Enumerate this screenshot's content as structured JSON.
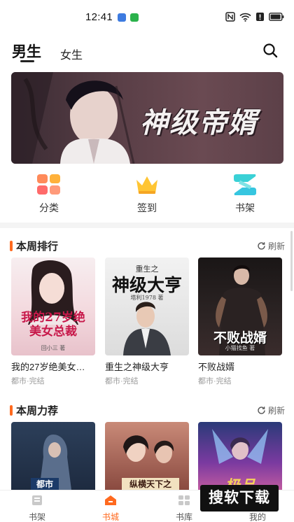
{
  "status_bar": {
    "time": "12:41"
  },
  "header": {
    "tabs": [
      {
        "label": "男生"
      },
      {
        "label": "女生"
      }
    ]
  },
  "banner": {
    "title": "神级帝婿"
  },
  "quick_entries": [
    {
      "label": "分类",
      "icon": "category-icon"
    },
    {
      "label": "签到",
      "icon": "crown-icon"
    },
    {
      "label": "书架",
      "icon": "bookshelf-icon"
    }
  ],
  "sections": [
    {
      "title": "本周排行",
      "refresh_label": "刷新",
      "books": [
        {
          "title": "我的27岁绝美女…",
          "meta": "都市·完结",
          "cover_text": "我的27岁绝美女总裁",
          "cover_sub": "回小三 著"
        },
        {
          "title": "重生之神级大亨",
          "meta": "都市·完结",
          "cover_text": "神级大亨",
          "cover_top": "重生之",
          "cover_sub": "塔利1978 著"
        },
        {
          "title": "不败战婿",
          "meta": "都市·完结",
          "cover_text": "不败战婿",
          "cover_sub": "小猫找鱼 著"
        }
      ]
    },
    {
      "title": "本周力荐",
      "refresh_label": "刷新",
      "books": [
        {
          "cover_text": "都市"
        },
        {
          "cover_text": "纵横天下之"
        },
        {
          "cover_text": "极品"
        }
      ]
    }
  ],
  "bottom_nav": [
    {
      "label": "书架",
      "active": false
    },
    {
      "label": "书城",
      "active": true
    },
    {
      "label": "书库",
      "active": false
    },
    {
      "label": "我的",
      "active": false
    }
  ],
  "watermark": "搜软下载",
  "colors": {
    "accent": "#ff6a1f"
  }
}
